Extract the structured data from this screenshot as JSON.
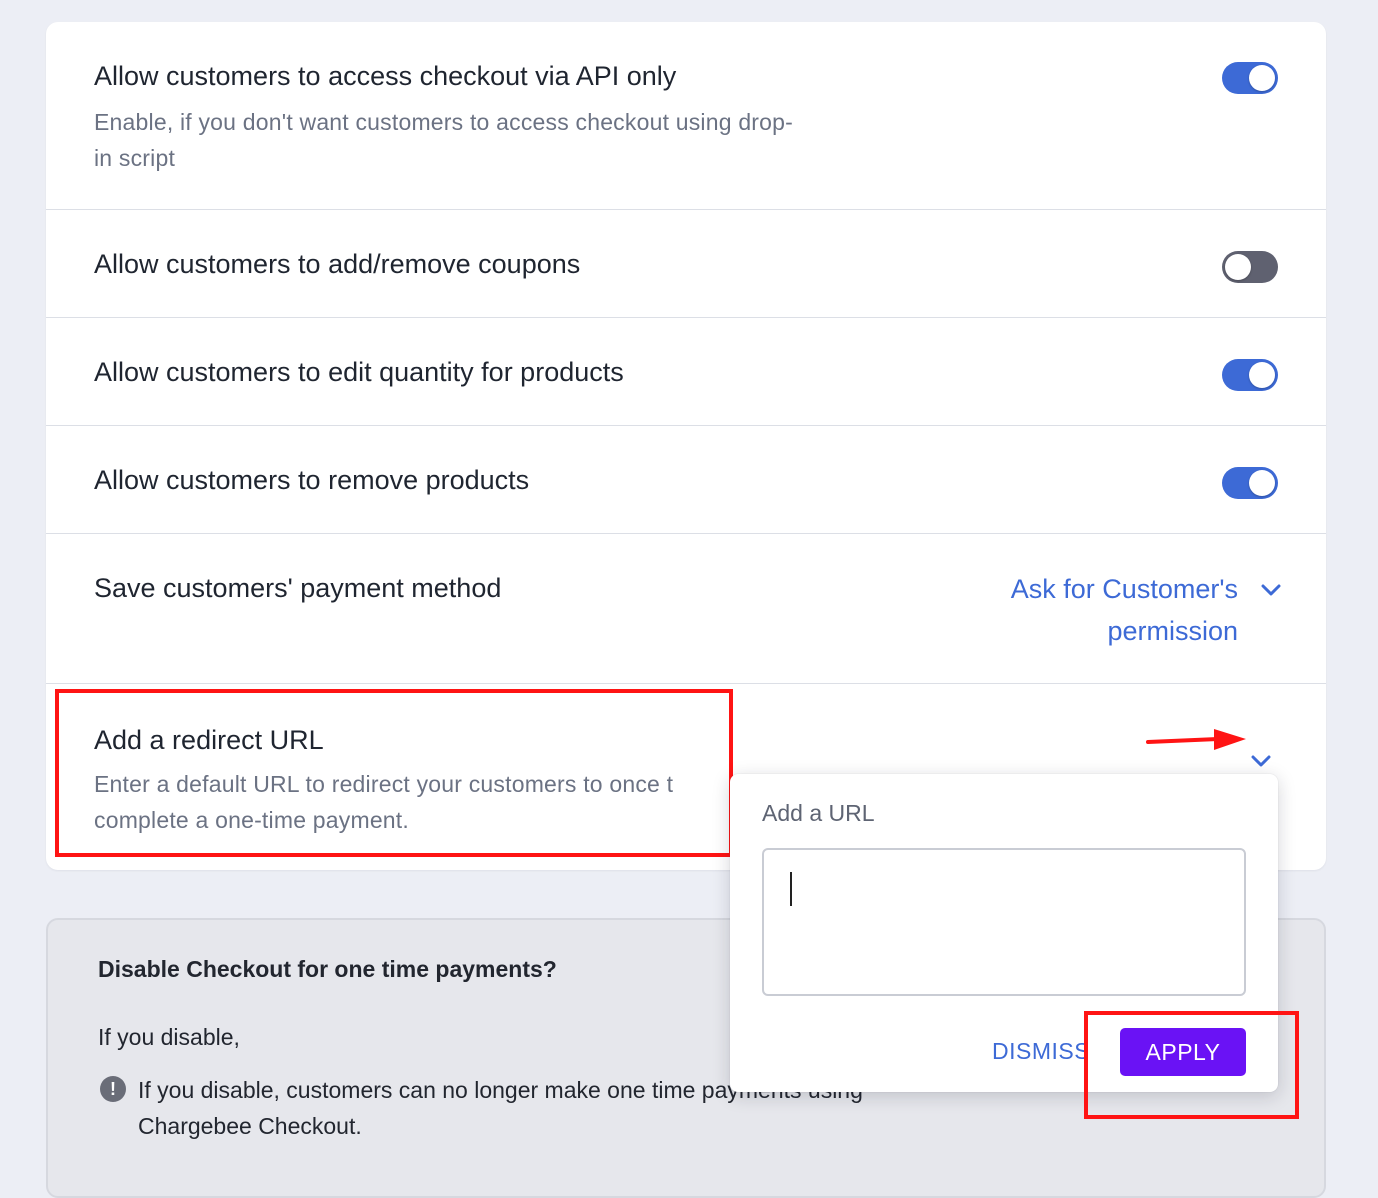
{
  "settings": {
    "api_only": {
      "title": "Allow customers to access checkout via API only",
      "description_line1": "Enable, if you don't want customers to access checkout using drop-",
      "description_line2": "in script",
      "enabled": true
    },
    "coupons": {
      "title": "Allow customers to add/remove coupons",
      "enabled": false
    },
    "edit_quantity": {
      "title": "Allow customers to edit quantity for products",
      "enabled": true
    },
    "remove_products": {
      "title": "Allow customers to remove products",
      "enabled": true
    },
    "save_payment": {
      "title": "Save customers' payment method",
      "value_line1": "Ask for Customer's",
      "value_line2": "permission"
    },
    "redirect_url": {
      "title": "Add a redirect URL",
      "description_line1": "Enter a default URL to redirect your customers to once t",
      "description_line2": "complete a one-time payment."
    }
  },
  "popover": {
    "label": "Add a URL",
    "input_value": "",
    "dismiss_label": "DISMISS",
    "apply_label": "APPLY"
  },
  "disable_box": {
    "title": "Disable Checkout for one time payments?",
    "subtitle": "If you disable,",
    "warning_line1": "If you disable, customers can no longer make one time payments using",
    "warning_line2": "Chargebee Checkout.",
    "info_icon_glyph": "!"
  },
  "icons": {
    "toggle": "toggle-switch-icon",
    "chevron": "chevron-down-icon",
    "info": "info-icon",
    "arrow": "annotation-arrow-icon"
  },
  "colors": {
    "accent_blue": "#3d6ad6",
    "toggle_off": "#5f6170",
    "apply_purple": "#6a12f5",
    "annotation_red": "#ff1414"
  }
}
